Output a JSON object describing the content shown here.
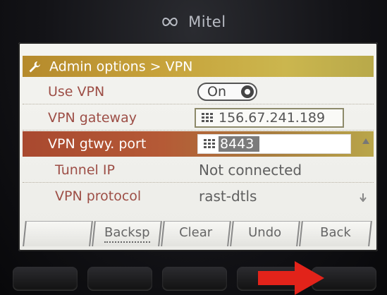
{
  "brand": {
    "name": "Mitel",
    "logo_icon": "mitel-infinity-logo"
  },
  "header": {
    "icon": "wrench-icon",
    "breadcrumb": "Admin options > VPN"
  },
  "settings": {
    "use_vpn": {
      "label": "Use VPN",
      "toggle_value": "On",
      "enabled": true
    },
    "vpn_gateway": {
      "label": "VPN gateway",
      "value": "156.67.241.189",
      "input_icon": "keypad-icon"
    },
    "vpn_gtwy_port": {
      "label": "VPN gtwy. port",
      "value": "8443",
      "input_icon": "keypad-icon",
      "selected": true
    },
    "tunnel_ip": {
      "label": "Tunnel IP",
      "value": "Not connected"
    },
    "vpn_protocol": {
      "label": "VPN protocol",
      "value": "rast-dtls"
    }
  },
  "softkeys": {
    "key1": "",
    "key2": "Backsp",
    "key3": "Clear",
    "key4": "Undo",
    "key5": "Back"
  },
  "colors": {
    "title_bar": "#c7a33b",
    "selected_row": "#a9492f",
    "label_text": "#9d4e46",
    "value_text": "#5f5f5f",
    "annotation_arrow": "#e2231a"
  }
}
